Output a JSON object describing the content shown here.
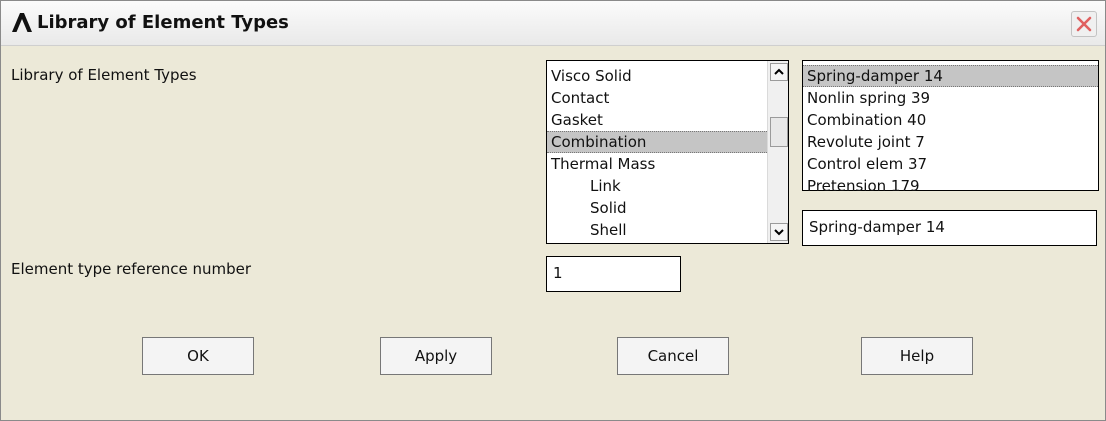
{
  "window": {
    "title": "Library of Element Types"
  },
  "form": {
    "library_label": "Library of Element Types",
    "ref_label": "Element type reference number",
    "ref_value": "1"
  },
  "category_list": {
    "items": [
      "Visco Solid",
      "Contact",
      "Gasket",
      "Combination",
      "Thermal Mass",
      "Link",
      "Solid",
      "Shell"
    ],
    "selected": "Combination"
  },
  "type_list": {
    "items": [
      "Spring-damper 14",
      "Nonlin spring 39",
      "Combination  40",
      "Revolute joint 7",
      "Control elem 37",
      "Pretension  179"
    ],
    "selected": "Spring-damper 14"
  },
  "selected_type_value": "Spring-damper 14",
  "buttons": {
    "ok": "OK",
    "apply": "Apply",
    "cancel": "Cancel",
    "help": "Help"
  },
  "colors": {
    "dialog_background": "#ece9d8",
    "selection": "#c5c5c5",
    "close_button": "#e06060"
  }
}
